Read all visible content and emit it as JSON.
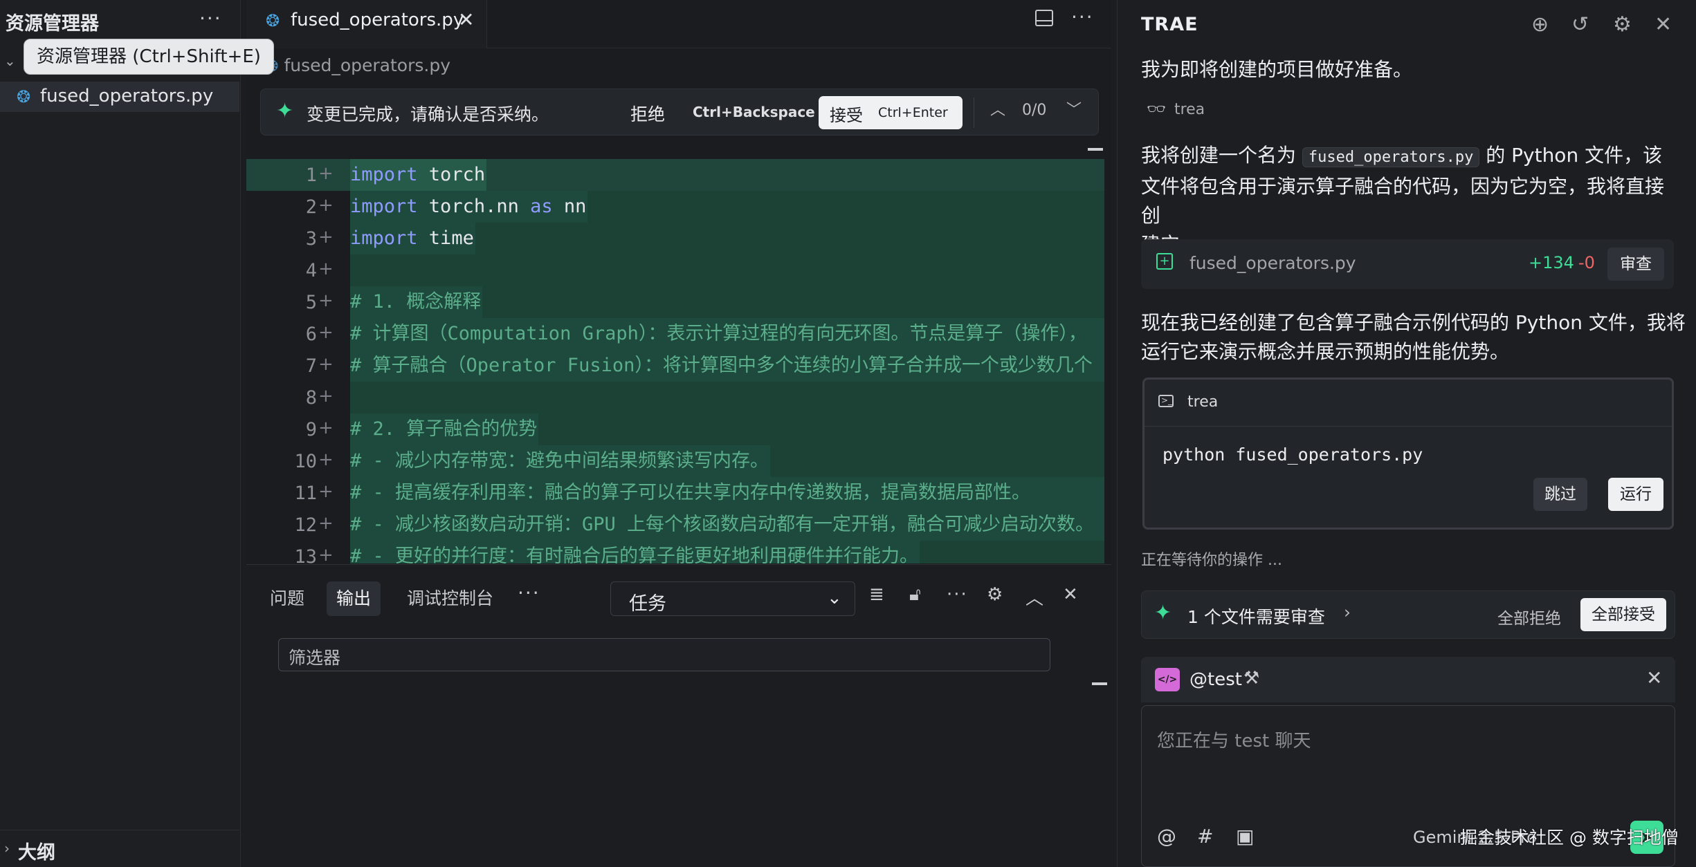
{
  "sidebar": {
    "title": "资源管理器",
    "more": "···",
    "tooltip": "资源管理器 (Ctrl+Shift+E)",
    "file": "fused_operators.py",
    "outline": "大纲"
  },
  "editor": {
    "tab_label": "fused_operators.py",
    "tab_close": "✕",
    "more": "···",
    "breadcrumb": "fused_operators.py",
    "review": {
      "message": "变更已完成，请确认是否采纳。",
      "reject": "拒绝",
      "reject_key": "Ctrl+Backspace",
      "accept": "接受",
      "accept_key": "Ctrl+Enter",
      "counter": "0/0"
    },
    "lines": [
      {
        "n": "1",
        "parts": [
          [
            "kw",
            "import"
          ],
          [
            "id",
            " torch"
          ]
        ]
      },
      {
        "n": "2",
        "parts": [
          [
            "kw",
            "import"
          ],
          [
            "id",
            " torch.nn "
          ],
          [
            "kw",
            "as"
          ],
          [
            "id",
            " nn"
          ]
        ]
      },
      {
        "n": "3",
        "parts": [
          [
            "kw",
            "import"
          ],
          [
            "id",
            " time"
          ]
        ]
      },
      {
        "n": "4",
        "parts": []
      },
      {
        "n": "5",
        "parts": [
          [
            "cm",
            "# 1. 概念解释"
          ]
        ]
      },
      {
        "n": "6",
        "parts": [
          [
            "cm",
            "# 计算图（Computation Graph）：表示计算过程的有向无环图。节点是算子（操作），"
          ]
        ]
      },
      {
        "n": "7",
        "parts": [
          [
            "cm",
            "# 算子融合（Operator Fusion）：将计算图中多个连续的小算子合并成一个或少数几个"
          ]
        ]
      },
      {
        "n": "8",
        "parts": []
      },
      {
        "n": "9",
        "parts": [
          [
            "cm",
            "# 2. 算子融合的优势"
          ]
        ]
      },
      {
        "n": "10",
        "parts": [
          [
            "cm",
            "# - 减少内存带宽：避免中间结果频繁读写内存。"
          ]
        ]
      },
      {
        "n": "11",
        "parts": [
          [
            "cm",
            "# - 提高缓存利用率：融合的算子可以在共享内存中传递数据，提高数据局部性。"
          ]
        ]
      },
      {
        "n": "12",
        "parts": [
          [
            "cm",
            "# - 减少核函数启动开销：GPU 上每个核函数启动都有一定开销，融合可减少启动次数。"
          ]
        ]
      },
      {
        "n": "13",
        "parts": [
          [
            "cm",
            "# - 更好的并行度：有时融合后的算子能更好地利用硬件并行能力。"
          ]
        ]
      }
    ]
  },
  "panel": {
    "tabs": [
      "问题",
      "输出",
      "调试控制台"
    ],
    "more": "···",
    "select_value": "任务",
    "filter_placeholder": "筛选器"
  },
  "chat": {
    "brand": "TRAE",
    "p1": "我为即将创建的项目做好准备。",
    "agent_tag": "trea",
    "p2_before": "我将创建一个名为 ",
    "p2_code": "fused_operators.py",
    "p2_after_1": " 的 Python 文件，该",
    "p2_line2": "文件将包含用于演示算子融合的代码，因为它为空，我将直接创",
    "p2_line3": "建它。",
    "file_card": {
      "name": "fused_operators.py",
      "added": "+134",
      "removed": "-0",
      "review": "审查"
    },
    "p3_line1": "现在我已经创建了包含算子融合示例代码的 Python 文件，我将",
    "p3_line2": "运行它来演示概念并展示预期的性能优势。",
    "terminal": {
      "name": "trea",
      "command": "python fused_operators.py",
      "skip": "跳过",
      "run": "运行"
    },
    "waiting": "正在等待你的操作 ...",
    "review_summary": {
      "label": "1 个文件需要审查",
      "reject_all": "全部拒绝",
      "accept_all": "全部接受"
    },
    "composer": {
      "agent": "@test",
      "placeholder": "您正在与 test 聊天",
      "model": "Gemini-2.5-Pro"
    }
  },
  "watermark": "掘金技术社区 @ 数字扫地僧"
}
